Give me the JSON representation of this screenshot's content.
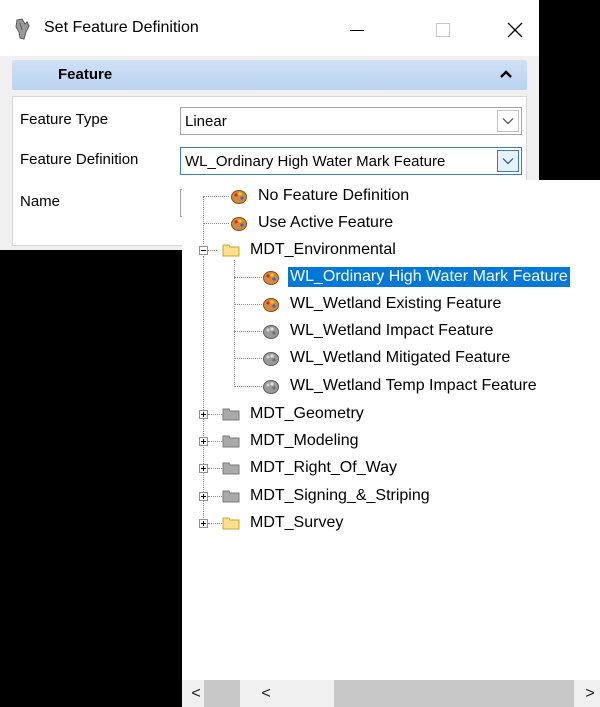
{
  "window": {
    "title": "Set Feature Definition",
    "icons": {
      "app": "pen-hand-icon",
      "minimize": "minimize-icon",
      "maximize": "maximize-icon",
      "close": "close-icon"
    }
  },
  "panel": {
    "header": "Feature",
    "collapse_icon": "chevron-up-icon"
  },
  "form": {
    "feature_type_label": "Feature Type",
    "feature_type_value": "Linear",
    "feature_definition_label": "Feature Definition",
    "feature_definition_value": "WL_Ordinary High Water Mark Feature",
    "name_label": "Name"
  },
  "tree": {
    "items": [
      {
        "label": "No Feature Definition",
        "icon": "feature-palette-icon"
      },
      {
        "label": "Use Active Feature",
        "icon": "feature-palette-icon"
      },
      {
        "label": "MDT_Environmental",
        "icon": "folder-open-icon",
        "expanded": true
      },
      {
        "label": "WL_Ordinary High Water Mark Feature",
        "icon": "feature-palette-icon",
        "selected": true
      },
      {
        "label": "WL_Wetland Existing Feature",
        "icon": "feature-palette-icon"
      },
      {
        "label": "WL_Wetland Impact Feature",
        "icon": "feature-palette-gray-icon"
      },
      {
        "label": "WL_Wetland Mitigated Feature",
        "icon": "feature-palette-gray-icon"
      },
      {
        "label": "WL_Wetland Temp Impact Feature",
        "icon": "feature-palette-gray-icon"
      },
      {
        "label": "MDT_Geometry",
        "icon": "folder-gray-icon"
      },
      {
        "label": "MDT_Modeling",
        "icon": "folder-gray-icon"
      },
      {
        "label": "MDT_Right_Of_Way",
        "icon": "folder-gray-icon"
      },
      {
        "label": "MDT_Signing_&_Striping",
        "icon": "folder-gray-icon"
      },
      {
        "label": "MDT_Survey",
        "icon": "folder-yellow-icon"
      }
    ]
  },
  "scrollbar": {
    "left_arrow": "<",
    "right_arrow": ">"
  },
  "colors": {
    "selection": "#0078d7",
    "header_gradient": "#c5dbf4",
    "client_bg": "#f0f0f0"
  }
}
